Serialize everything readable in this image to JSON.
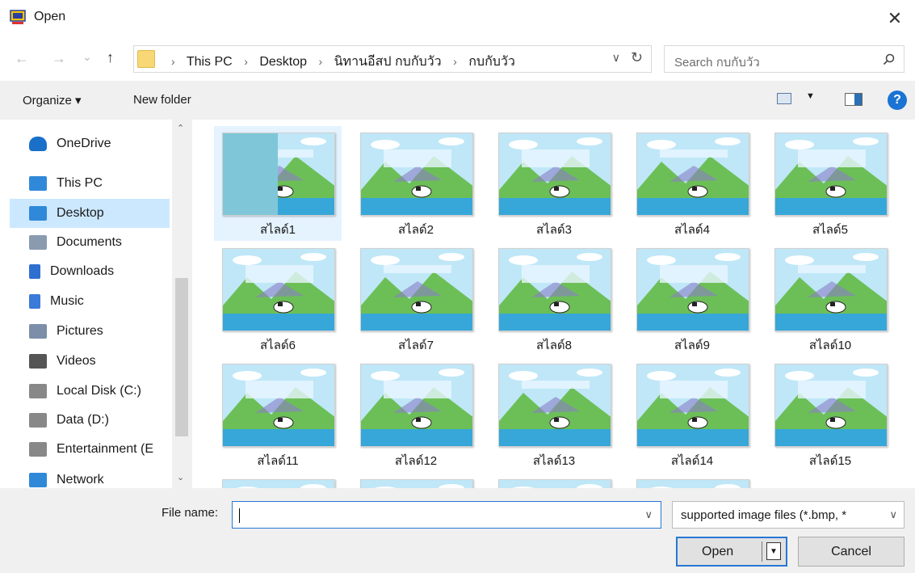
{
  "window": {
    "title": "Open",
    "close_glyph": "✕"
  },
  "nav": {
    "back_glyph": "←",
    "forward_glyph": "→",
    "recent_glyph": "⌄",
    "up_glyph": "↑",
    "breadcrumbs": [
      "This PC",
      "Desktop",
      "นิทานอีสป กบกับวัว",
      "กบกับวัว"
    ],
    "separator": "›",
    "refresh_glyph": "↻"
  },
  "search": {
    "placeholder": "Search กบกับวัว"
  },
  "toolbar": {
    "organize_label": "Organize ▾",
    "new_folder_label": "New folder",
    "help_glyph": "?"
  },
  "sidebar": {
    "items": [
      {
        "label": "OneDrive",
        "icon": "cloud-icon",
        "color": "#1a6fc9"
      },
      {
        "label": "This PC",
        "icon": "computer-icon",
        "color": "#2f89d8"
      },
      {
        "label": "Desktop",
        "icon": "desktop-icon",
        "color": "#2f89d8",
        "selected": true
      },
      {
        "label": "Documents",
        "icon": "document-icon",
        "color": "#8a9bb0"
      },
      {
        "label": "Downloads",
        "icon": "download-icon",
        "color": "#2f6fd0"
      },
      {
        "label": "Music",
        "icon": "music-icon",
        "color": "#3a7ad8"
      },
      {
        "label": "Pictures",
        "icon": "pictures-icon",
        "color": "#7c8ea8"
      },
      {
        "label": "Videos",
        "icon": "videos-icon",
        "color": "#555"
      },
      {
        "label": "Local Disk (C:)",
        "icon": "drive-c-icon",
        "color": "#888"
      },
      {
        "label": "Data (D:)",
        "icon": "drive-d-icon",
        "color": "#888"
      },
      {
        "label": "Entertainment (E",
        "icon": "drive-e-icon",
        "color": "#888"
      },
      {
        "label": "Network",
        "icon": "network-icon",
        "color": "#2f89d8"
      }
    ]
  },
  "files": [
    {
      "name": "สไลด์1"
    },
    {
      "name": "สไลด์2"
    },
    {
      "name": "สไลด์3"
    },
    {
      "name": "สไลด์4"
    },
    {
      "name": "สไลด์5"
    },
    {
      "name": "สไลด์6"
    },
    {
      "name": "สไลด์7"
    },
    {
      "name": "สไลด์8"
    },
    {
      "name": "สไลด์9"
    },
    {
      "name": "สไลด์10"
    },
    {
      "name": "สไลด์11"
    },
    {
      "name": "สไลด์12"
    },
    {
      "name": "สไลด์13"
    },
    {
      "name": "สไลด์14"
    },
    {
      "name": "สไลด์15"
    },
    {
      "name": ""
    },
    {
      "name": ""
    },
    {
      "name": ""
    },
    {
      "name": ""
    }
  ],
  "bottom": {
    "file_name_label": "File name:",
    "file_name_value": "",
    "file_type_value": "supported image files (*.bmp, *",
    "open_label": "Open",
    "cancel_label": "Cancel",
    "dropdown_glyph": "∨"
  },
  "colors": {
    "accent": "#2678d4",
    "selection": "#cce8ff",
    "toolbar_bg": "#f0f0f0"
  }
}
